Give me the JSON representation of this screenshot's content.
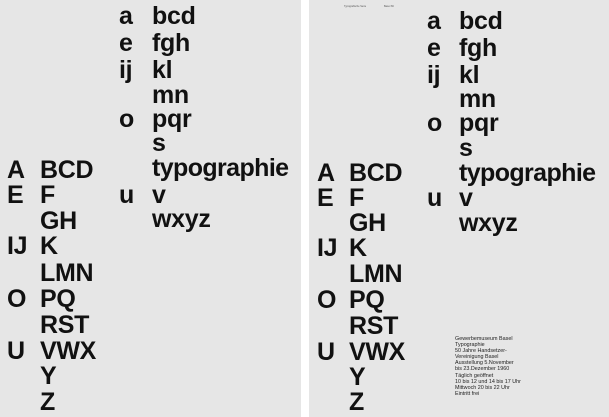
{
  "lowercase": {
    "vowels": [
      "a",
      "e",
      "ij",
      "o",
      "u"
    ],
    "consonants": [
      "bcd",
      "fgh",
      "kl",
      "mn",
      "pqr",
      "s",
      "typographie",
      "v",
      "wxyz"
    ]
  },
  "uppercase": {
    "vowels": [
      "A",
      "E",
      "IJ",
      "O",
      "U"
    ],
    "consonants": [
      "BCD",
      "F",
      "GH",
      "K",
      "LMN",
      "PQ",
      "RST",
      "VWX",
      "Y",
      "Z"
    ]
  },
  "small_header": [
    "Typografische Serie",
    "Basel 66"
  ],
  "info_lines": [
    "Gewerbemuseum Basel",
    "Typographie",
    "50 Jahre Handsetzer-",
    "Vereinigung Basel",
    "Ausstellung 5.November",
    "bis 23.Dezember 1960",
    "Täglich geöffnet",
    "10 bis 12 und 14 bis 17 Uhr",
    "Mittwoch 20 bis 22 Uhr",
    "Eintritt frei"
  ]
}
